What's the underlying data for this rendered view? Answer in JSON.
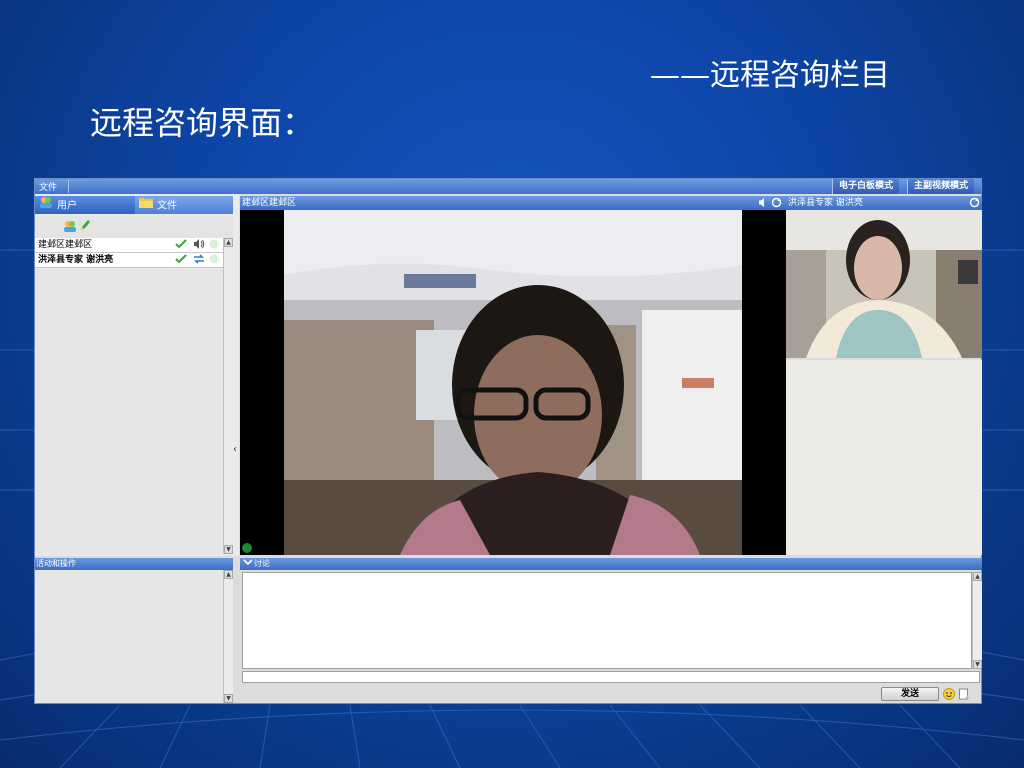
{
  "slide": {
    "subtitle": "——远程咨询栏目",
    "title": "远程咨询界面："
  },
  "app": {
    "menu": {
      "file": "文件"
    },
    "modes": {
      "whiteboard": "电子白板模式",
      "main_sub_video": "主副视频模式"
    },
    "tabs": {
      "users": "用户",
      "files": "文件"
    },
    "users": [
      {
        "name": "建邺区建邺区"
      },
      {
        "name": "洪泽县专家 谢洪亮"
      }
    ],
    "main_video": {
      "title": "建邺区建邺区"
    },
    "side_video": {
      "title": "洪泽县专家 谢洪亮"
    },
    "activity": {
      "title": "活动和操作"
    },
    "discussion": {
      "title": "讨论",
      "send_label": "发送"
    }
  },
  "colors": {
    "background": "#0d45a6",
    "titlebar": "#3f71c8",
    "panel": "#e6e6e6",
    "check_green": "#3aa53a"
  }
}
